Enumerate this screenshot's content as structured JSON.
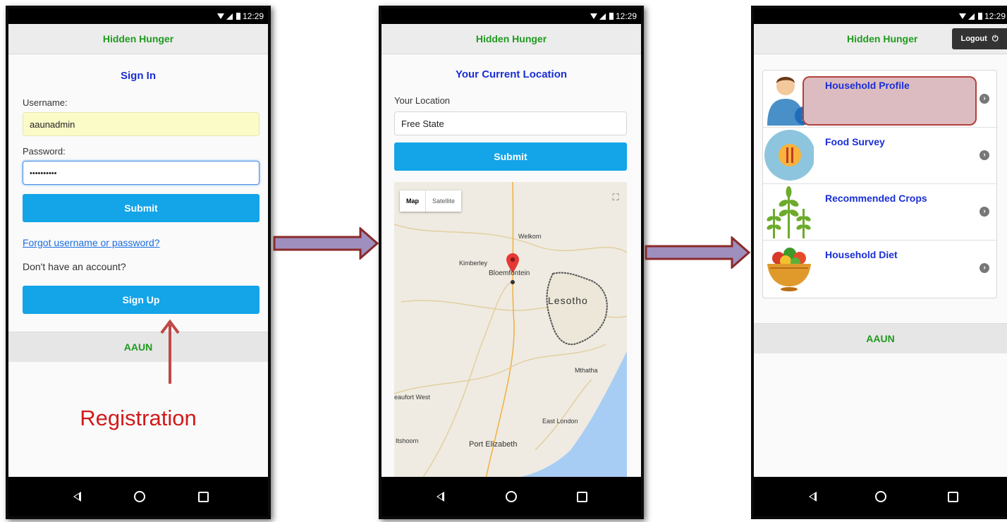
{
  "status": {
    "time": "12:29"
  },
  "app": {
    "title": "Hidden Hunger",
    "footer": "AAUN"
  },
  "signin": {
    "heading": "Sign In",
    "username_label": "Username:",
    "username_value": "aaunadmin",
    "password_label": "Password:",
    "password_value": "••••••••••",
    "submit": "Submit",
    "forgot": "Forgot username or password?",
    "no_account": "Don't have an account?",
    "signup": "Sign Up",
    "annotation": "Registration"
  },
  "location": {
    "heading": "Your Current Location",
    "label": "Your Location",
    "value": "Free State",
    "submit": "Submit",
    "map_tab": "Map",
    "satellite_tab": "Satellite",
    "places": {
      "welkom": "Welkom",
      "kimberley": "Kimberley",
      "bloemfontein": "Bloemfontein",
      "lesotho": "Lesotho",
      "mthatha": "Mthatha",
      "beaufort_west": "Beaufort West",
      "east_london": "East London",
      "port_elizabeth": "Port Elizabeth",
      "oudtshoorn": "Itshoorn"
    }
  },
  "menu": {
    "logout": "Logout",
    "items": [
      {
        "label": "Household Profile"
      },
      {
        "label": "Food Survey"
      },
      {
        "label": "Recommended Crops"
      },
      {
        "label": "Household Diet"
      }
    ]
  },
  "colors": {
    "accent_button": "#14a4e8",
    "title_green": "#1f9a1f",
    "heading_blue": "#1a2ed6",
    "annotation_red": "#d11a1a",
    "arrow_fill": "#9f8fbf",
    "arrow_border": "#8b2a2a",
    "highlight": "#dcbcc0"
  }
}
